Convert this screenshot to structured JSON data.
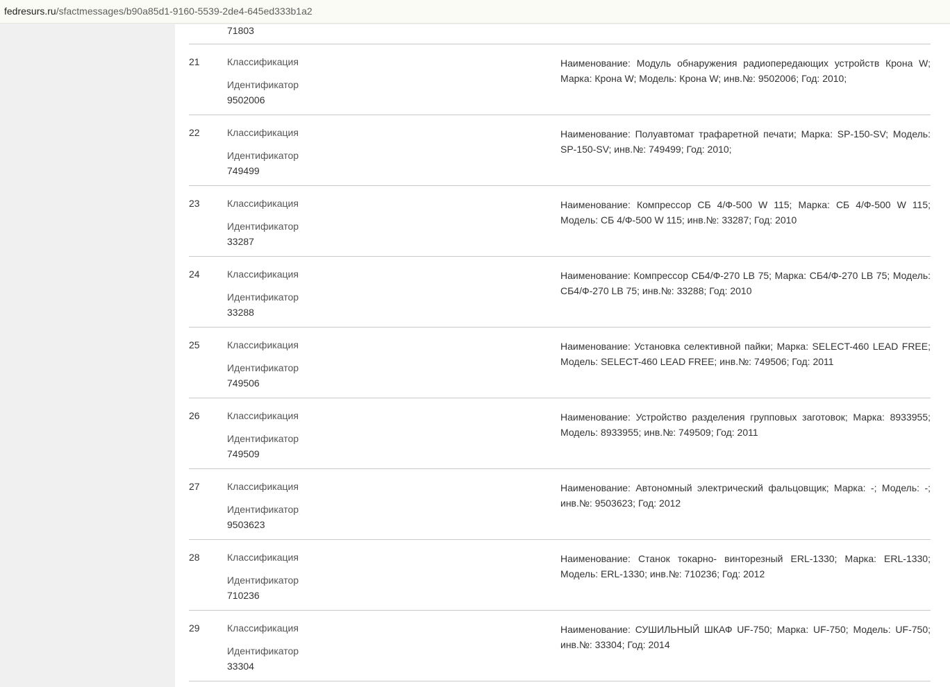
{
  "browser": {
    "url_domain": "fedresurs.ru",
    "url_path": "/sfactmessages/b90a85d1-9160-5539-2de4-645ed333b1a2"
  },
  "table": {
    "previous_identifier": "71803",
    "rows": [
      {
        "number": "21",
        "classification_label": "Классификация",
        "identifier_label": "Идентификатор",
        "identifier": "9502006",
        "description": "Наименование: Модуль обнаружения радиопередающих устройств Крона W; Марка: Крона W; Модель: Крона W; инв.№: 9502006; Год: 2010;"
      },
      {
        "number": "22",
        "classification_label": "Классификация",
        "identifier_label": "Идентификатор",
        "identifier": "749499",
        "description": "Наименование: Полуавтомат трафаретной печати; Марка: SP-150-SV; Модель: SP-150-SV; инв.№: 749499; Год: 2010;"
      },
      {
        "number": "23",
        "classification_label": "Классификация",
        "identifier_label": "Идентификатор",
        "identifier": "33287",
        "description": "Наименование: Компрессор СБ 4/Ф-500 W 115; Марка: СБ 4/Ф-500 W 115; Модель: СБ 4/Ф-500 W 115; инв.№: 33287; Год: 2010"
      },
      {
        "number": "24",
        "classification_label": "Классификация",
        "identifier_label": "Идентификатор",
        "identifier": "33288",
        "description": "Наименование: Компрессор СБ4/Ф-270 LB 75; Марка: СБ4/Ф-270 LB 75; Модель: СБ4/Ф-270 LB 75; инв.№: 33288; Год: 2010"
      },
      {
        "number": "25",
        "classification_label": "Классификация",
        "identifier_label": "Идентификатор",
        "identifier": "749506",
        "description": "Наименование: Установка селективной пайки; Марка: SELECT-460 LEAD FREE; Модель: SELECT-460 LEAD FREE; инв.№: 749506; Год: 2011"
      },
      {
        "number": "26",
        "classification_label": "Классификация",
        "identifier_label": "Идентификатор",
        "identifier": "749509",
        "description": "Наименование: Устройство разделения групповых заготовок; Марка: 8933955; Модель: 8933955; инв.№: 749509; Год: 2011"
      },
      {
        "number": "27",
        "classification_label": "Классификация",
        "identifier_label": "Идентификатор",
        "identifier": "9503623",
        "description": "Наименование: Автономный электрический фальцовщик; Марка: -; Модель: -; инв.№: 9503623; Год: 2012"
      },
      {
        "number": "28",
        "classification_label": "Классификация",
        "identifier_label": "Идентификатор",
        "identifier": "710236",
        "description": "Наименование: Станок токарно- винторезный ERL-1330; Марка: ERL-1330; Модель: ERL-1330; инв.№: 710236; Год: 2012"
      },
      {
        "number": "29",
        "classification_label": "Классификация",
        "identifier_label": "Идентификатор",
        "identifier": "33304",
        "description": "Наименование: СУШИЛЬНЫЙ ШКАФ UF-750; Марка: UF-750; Модель: UF-750; инв.№: 33304; Год: 2014"
      }
    ]
  }
}
